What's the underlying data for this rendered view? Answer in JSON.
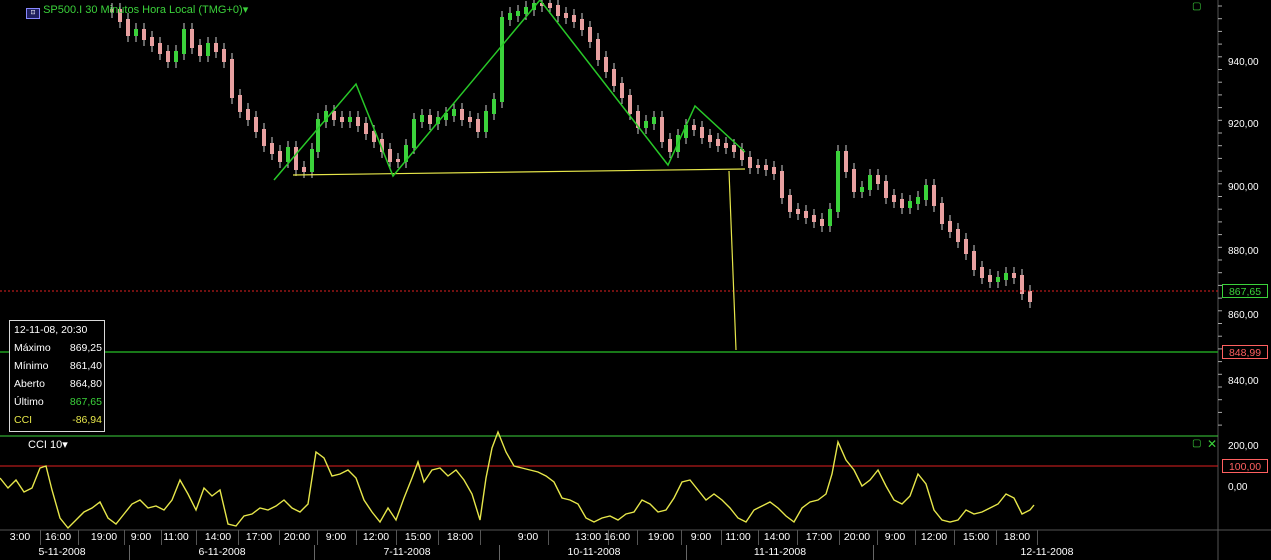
{
  "window": {
    "title": "SP500.I 30 Minutos Hora Local (TMG+0)",
    "icon": "chart-window-icon"
  },
  "price_axis": {
    "labels": [
      "940,00",
      "920,00",
      "900,00",
      "880,00",
      "860,00",
      "840,00"
    ],
    "last_price": "867,65",
    "target_price": "848,99"
  },
  "cci_panel": {
    "title": "CCI 10",
    "axis_labels": [
      "200,00",
      "100,00",
      "0,00"
    ],
    "level_label": "100,00"
  },
  "info_box": {
    "date": "12-11-08, 20:30",
    "rows": [
      {
        "key": "Máximo",
        "value": "869,25"
      },
      {
        "key": "Mínimo",
        "value": "861,40"
      },
      {
        "key": "Aberto",
        "value": "864,80"
      },
      {
        "key": "Último",
        "value": "867,65"
      },
      {
        "key": "CCI",
        "value": "-86,94"
      }
    ]
  },
  "time_axis": {
    "times": [
      "3:00",
      "16:00",
      "19:00",
      "9:00",
      "11:00",
      "14:00",
      "17:00",
      "20:00",
      "9:00",
      "12:00",
      "15:00",
      "18:00",
      "9:00",
      "13:00",
      "16:00",
      "19:00",
      "9:00",
      "11:00",
      "14:00",
      "17:00",
      "20:00",
      "9:00",
      "12:00",
      "15:00",
      "18:00"
    ],
    "dates": [
      "5-11-2008",
      "6-11-2008",
      "7-11-2008",
      "10-11-2008",
      "11-11-2008",
      "12-11-2008"
    ]
  },
  "colors": {
    "up_candle": "#3bd23b",
    "down_candle": "#e8a0a0",
    "pattern_line": "#28c828",
    "neckline": "#e6e64a",
    "last_price_line": "#e02020",
    "target_line": "#20a020",
    "cci_line": "#e6e64a"
  }
}
